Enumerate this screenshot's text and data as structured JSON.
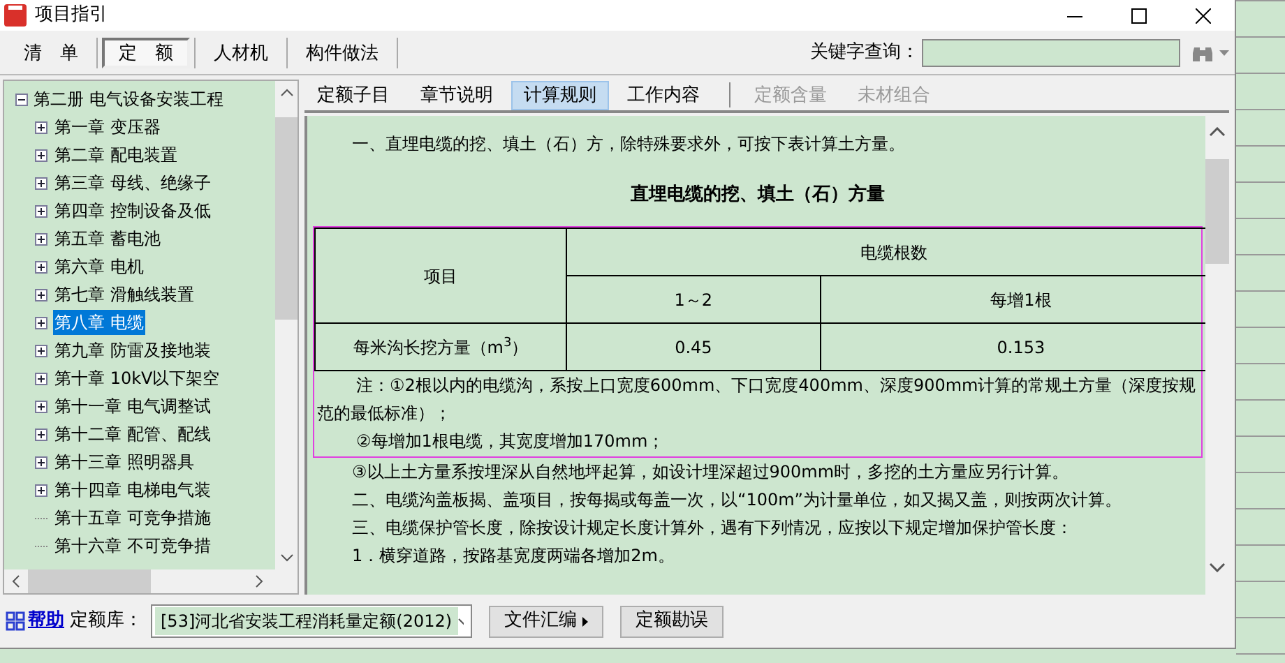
{
  "window": {
    "title": "项目指引"
  },
  "toolbar": {
    "tabs": [
      {
        "label": "清　单",
        "selected": false
      },
      {
        "label": "定　额",
        "selected": true
      },
      {
        "label": "人材机",
        "selected": false
      },
      {
        "label": "构件做法",
        "selected": false
      }
    ],
    "search": {
      "label": "关键字查询："
    }
  },
  "tree": {
    "label": "第二册  电气设备安装工程",
    "expanded": true,
    "selected": false,
    "children": [
      {
        "label": "第一章  变压器",
        "kind": "folder",
        "selected": false
      },
      {
        "label": "第二章  配电装置",
        "kind": "folder",
        "selected": false
      },
      {
        "label": "第三章  母线、绝缘子",
        "kind": "folder",
        "selected": false
      },
      {
        "label": "第四章  控制设备及低",
        "kind": "folder",
        "selected": false
      },
      {
        "label": "第五章  蓄电池",
        "kind": "folder",
        "selected": false
      },
      {
        "label": "第六章  电机",
        "kind": "folder",
        "selected": false
      },
      {
        "label": "第七章  滑触线装置",
        "kind": "folder",
        "selected": false
      },
      {
        "label": "第八章  电缆",
        "kind": "folder",
        "selected": true
      },
      {
        "label": "第九章  防雷及接地装",
        "kind": "folder",
        "selected": false
      },
      {
        "label": "第十章  10kV以下架空",
        "kind": "folder",
        "selected": false
      },
      {
        "label": "第十一章  电气调整试",
        "kind": "folder",
        "selected": false
      },
      {
        "label": "第十二章  配管、配线",
        "kind": "folder",
        "selected": false
      },
      {
        "label": "第十三章  照明器具",
        "kind": "folder",
        "selected": false
      },
      {
        "label": "第十四章  电梯电气装",
        "kind": "folder",
        "selected": false
      },
      {
        "label": "第十五章  可竞争措施",
        "kind": "leaf",
        "selected": false
      },
      {
        "label": "第十六章  不可竞争措",
        "kind": "leaf",
        "selected": false
      }
    ]
  },
  "content_tabs": [
    {
      "label": "定额子目",
      "selected": false,
      "disabled": false
    },
    {
      "label": "章节说明",
      "selected": false,
      "disabled": false
    },
    {
      "label": "计算规则",
      "selected": true,
      "disabled": false
    },
    {
      "label": "工作内容",
      "selected": false,
      "disabled": false
    },
    {
      "label": "定额含量",
      "selected": false,
      "disabled": true
    },
    {
      "label": "未材组合",
      "selected": false,
      "disabled": true
    }
  ],
  "content": {
    "intro": "一、直埋电缆的挖、填土（石）方，除特殊要求外，可按下表计算土方量。",
    "table_title": "直埋电缆的挖、填土（石）方量",
    "table": {
      "row_header": "项目",
      "group_header": "电缆根数",
      "columns": [
        "1～2",
        "每增1根"
      ],
      "rows": [
        {
          "label": "每米沟长挖方量（m$^{3}$）",
          "values": [
            "0.45",
            "0.153"
          ]
        }
      ]
    },
    "notes": [
      "注：①2根以内的电缆沟，系按上口宽度600mm、下口宽度400mm、深度900mm计算的常规土方量（深度按规范的最低标准）；",
      "②每增加1根电缆，其宽度增加170mm；",
      "③以上土方量系按埋深从自然地坪起算，如设计埋深超过900mm时，多挖的土方量应另行计算。",
      "二、电缆沟盖板揭、盖项目，按每揭或每盖一次，以“100m”为计量单位，如又揭又盖，则按两次计算。",
      "三、电缆保护管长度，除按设计规定长度计算外，遇有下列情况，应按以下规定增加保护管长度：",
      "1．横穿道路，按路基宽度两端各增加2m。"
    ]
  },
  "footer": {
    "help": "帮助",
    "library_label": "定额库：",
    "library": "[53]河北省安装工程消耗量定额(2012)",
    "buttons": [
      {
        "label": "文件汇编",
        "kind": "menu"
      },
      {
        "label": "定额勘误",
        "kind": "plain"
      }
    ]
  }
}
